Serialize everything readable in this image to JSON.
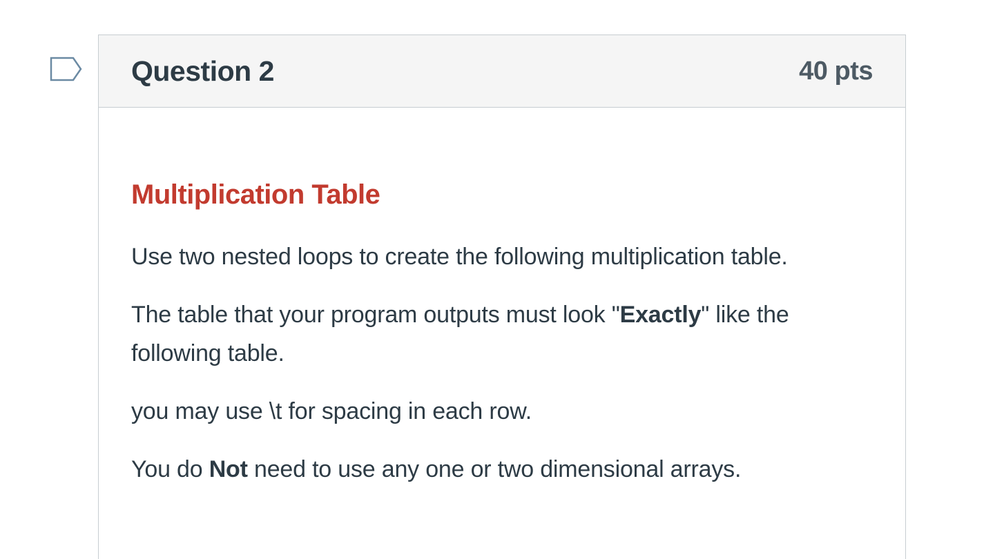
{
  "question": {
    "title": "Question 2",
    "points": "40 pts"
  },
  "content": {
    "heading": "Multiplication Table",
    "p1": "Use two nested loops to create the following multiplication table.",
    "p2_before": "The table that your program outputs must look \"",
    "p2_bold": "Exactly",
    "p2_after": "\" like the following table.",
    "p3": "you may use \\t for spacing in each row.",
    "p4_before": "You do ",
    "p4_bold": "Not",
    "p4_after": " need to use any one or two dimensional arrays."
  },
  "colors": {
    "heading": "#c23b2f",
    "text": "#2d3b45",
    "header_bg": "#f5f5f5",
    "border": "#c7cdd1",
    "flag": "#6b8aa3"
  },
  "icons": {
    "flag": "bookmark-flag-icon"
  }
}
